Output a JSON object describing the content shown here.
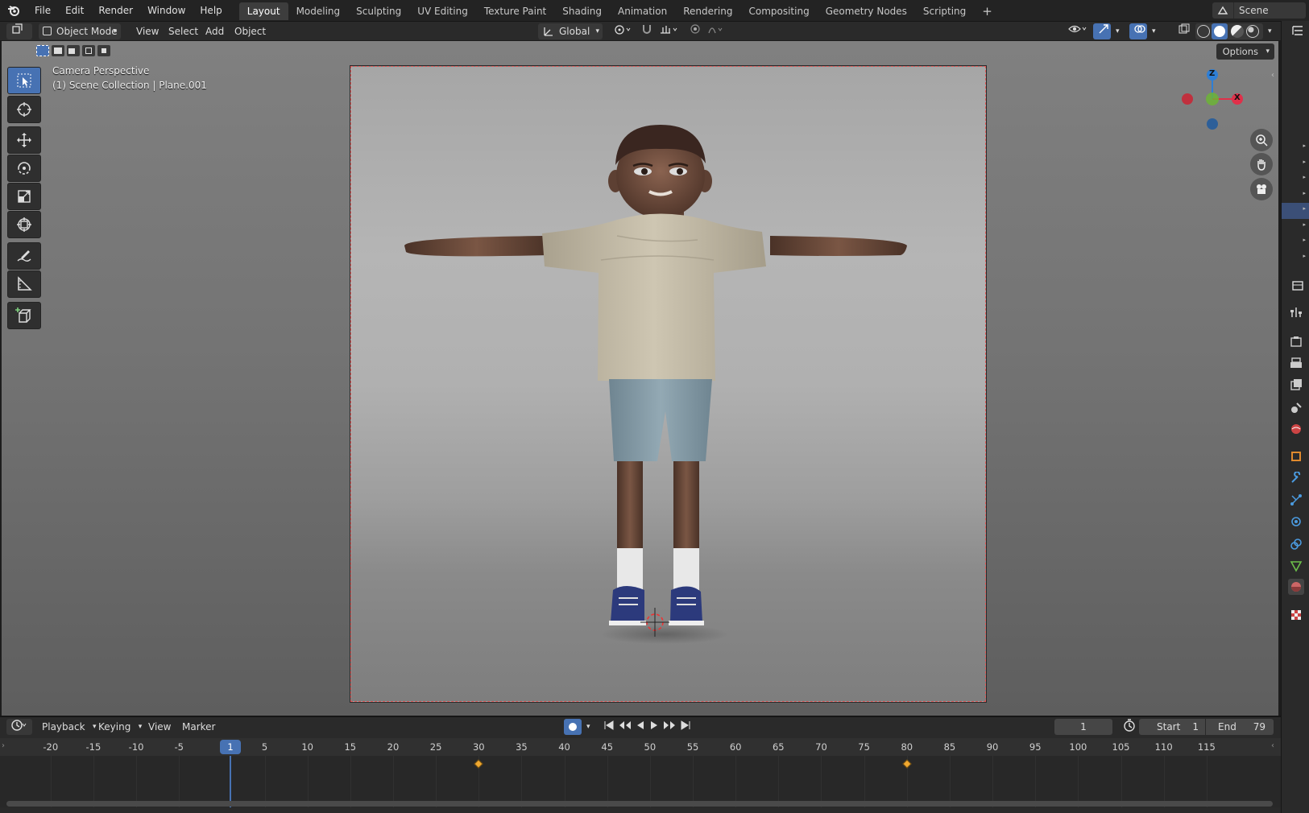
{
  "topbar": {
    "menus": [
      "File",
      "Edit",
      "Render",
      "Window",
      "Help"
    ],
    "workspaces": [
      "Layout",
      "Modeling",
      "Sculpting",
      "UV Editing",
      "Texture Paint",
      "Shading",
      "Animation",
      "Rendering",
      "Compositing",
      "Geometry Nodes",
      "Scripting"
    ],
    "active_workspace": "Layout",
    "add_tab": "+",
    "scene_label": "Scene"
  },
  "viewport_header": {
    "mode": "Object Mode",
    "menus": [
      "View",
      "Select",
      "Add",
      "Object"
    ],
    "transform_orientation": "Global",
    "options_label": "Options"
  },
  "viewport": {
    "camera_label": "Camera Perspective",
    "collection_label": "(1) Scene Collection | Plane.001",
    "gizmo": {
      "z": "Z",
      "x": "X"
    }
  },
  "timeline": {
    "menus": [
      "Playback",
      "Keying",
      "View",
      "Marker"
    ],
    "current_frame": "1",
    "start_label": "Start",
    "start_value": "1",
    "end_label": "End",
    "end_value": "79",
    "ruler_ticks": [
      "-20",
      "-15",
      "-10",
      "-5",
      "5",
      "10",
      "15",
      "20",
      "25",
      "30",
      "35",
      "40",
      "45",
      "50",
      "55",
      "60",
      "65",
      "70",
      "75",
      "80",
      "85",
      "90",
      "95",
      "100",
      "105",
      "110",
      "115"
    ],
    "playhead_label": "1",
    "keyframes": [
      30,
      80
    ]
  },
  "colors": {
    "accent": "#4772b3",
    "keyframe": "#f0a830",
    "camera_frame": "#e05a5a",
    "axis_x": "#e0304a",
    "axis_y": "#6cb832",
    "axis_z": "#2e7fd6"
  }
}
